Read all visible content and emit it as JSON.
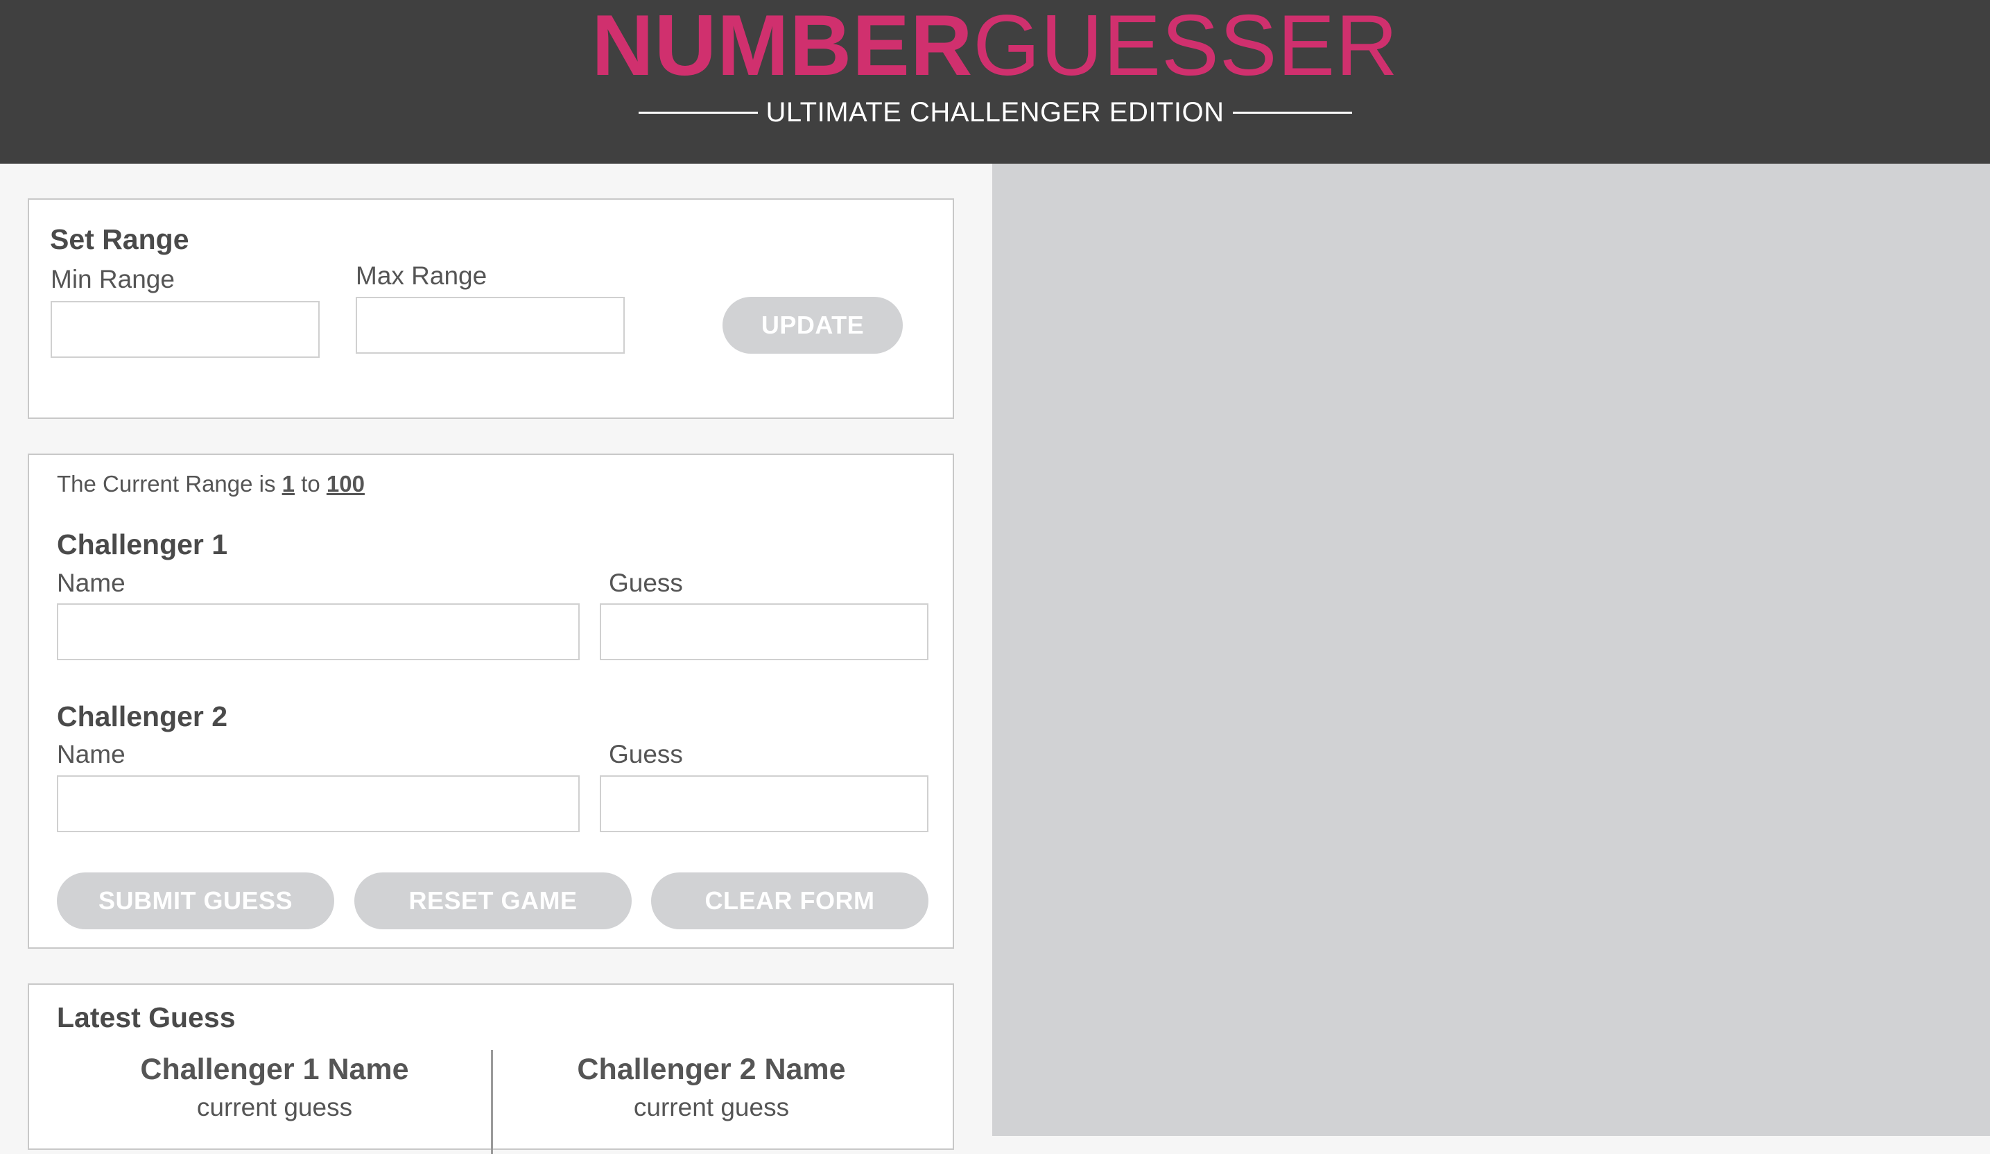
{
  "header": {
    "title_bold": "NUMBER",
    "title_light": "GUESSER",
    "subtitle": "ULTIMATE CHALLENGER EDITION"
  },
  "set_range": {
    "title": "Set Range",
    "min_label": "Min Range",
    "max_label": "Max Range",
    "min_value": "",
    "max_value": "",
    "update_label": "UPDATE"
  },
  "game": {
    "range_prefix": "The Current Range is",
    "range_min": "1",
    "range_to": "to",
    "range_max": "100",
    "challenger1": {
      "title": "Challenger 1",
      "name_label": "Name",
      "guess_label": "Guess",
      "name_value": "",
      "guess_value": ""
    },
    "challenger2": {
      "title": "Challenger 2",
      "name_label": "Name",
      "guess_label": "Guess",
      "name_value": "",
      "guess_value": ""
    },
    "buttons": {
      "submit": "SUBMIT GUESS",
      "reset": "RESET GAME",
      "clear": "CLEAR FORM"
    }
  },
  "latest": {
    "title": "Latest Guess",
    "challenger1_name": "Challenger 1 Name",
    "challenger1_guess": "current guess",
    "challenger2_name": "Challenger 2 Name",
    "challenger2_guess": "current guess"
  },
  "colors": {
    "header_bg": "#404040",
    "brand_pink": "#d0306e",
    "button_disabled": "#d1d2d4",
    "right_panel": "#d1d2d4"
  }
}
